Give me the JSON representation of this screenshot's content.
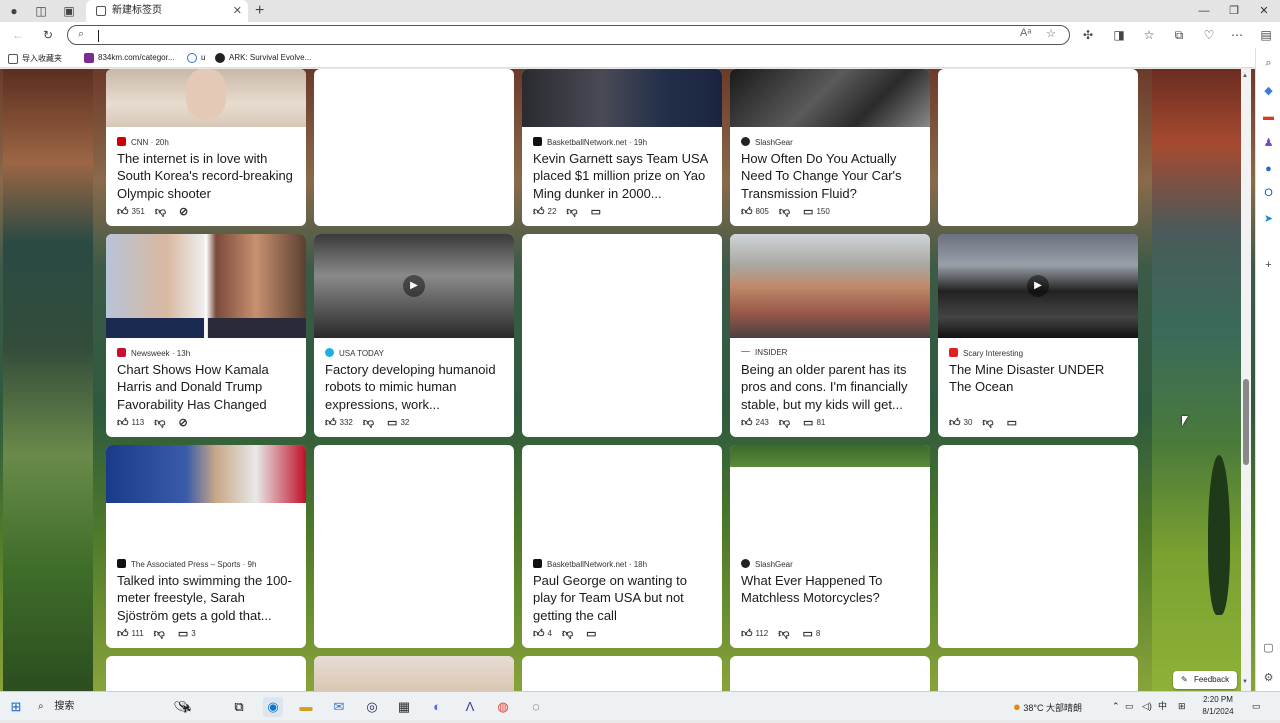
{
  "browser": {
    "tab_title": "新建标签页",
    "tab_close": "✕",
    "new_tab": "+",
    "address_value": "",
    "window_minimize": "—",
    "window_restore": "❐",
    "window_close": "✕"
  },
  "favorites": [
    {
      "label": "导入收藏夹",
      "color": "#555555"
    },
    {
      "label": "834km.com/categor...",
      "color": "#7b2d8e"
    },
    {
      "label": "u",
      "color": "#3a6fd8"
    },
    {
      "label": "ARK: Survival Evolve...",
      "color": "#222222"
    }
  ],
  "cards": {
    "c1": {
      "source": "CNN",
      "time": "20h",
      "title": "The internet is in love with South Korea's record-breaking Olympic shooter",
      "likes": "351",
      "comments": "",
      "logo_color": "#cc0000"
    },
    "c2": {
      "source": "BasketballNetwork.net",
      "time": "19h",
      "title": "Kevin Garnett says Team USA placed $1 million prize on Yao Ming dunker in 2000...",
      "likes": "22",
      "comments": "",
      "logo_color": "#111111"
    },
    "c3": {
      "source": "SlashGear",
      "time": "",
      "title": "How Often Do You Actually Need To Change Your Car's Transmission Fluid?",
      "likes": "805",
      "comments": "150",
      "logo_color": "#222222"
    },
    "c4": {
      "source": "Newsweek",
      "time": "13h",
      "title": "Chart Shows How Kamala Harris and Donald Trump Favorability Has Changed",
      "likes": "113",
      "comments": "",
      "logo_color": "#c8102e"
    },
    "c5": {
      "source": "USA TODAY",
      "time": "",
      "title": "Factory developing humanoid robots to mimic human expressions, work...",
      "likes": "332",
      "comments": "32",
      "logo_color": "#1ab0e0"
    },
    "c6": {
      "source": "INSIDER",
      "time": "",
      "title": "Being an older parent has its pros and cons. I'm financially stable, but my kids will get...",
      "likes": "243",
      "comments": "81",
      "logo_color": "#888888"
    },
    "c7": {
      "source": "Scary Interesting",
      "time": "",
      "title": "The Mine Disaster UNDER The Ocean",
      "likes": "30",
      "comments": "",
      "logo_color": "#e02020"
    },
    "c8": {
      "source": "The Associated Press – Sports",
      "time": "9h",
      "title": "Talked into swimming the 100-meter freestyle, Sarah Sjöström gets a gold that...",
      "likes": "111",
      "comments": "3",
      "logo_color": "#111111"
    },
    "c9": {
      "source": "BasketballNetwork.net",
      "time": "18h",
      "title": "Paul George on wanting to play for Team USA but not getting the call",
      "likes": "4",
      "comments": "",
      "logo_color": "#111111"
    },
    "c10": {
      "source": "SlashGear",
      "time": "",
      "title": "What Ever Happened To Matchless Motorcycles?",
      "likes": "112",
      "comments": "8",
      "logo_color": "#222222"
    }
  },
  "feedback_label": "Feedback",
  "taskbar": {
    "search_label": "搜索",
    "weather": "38°C 大部晴朗",
    "ime": "中",
    "time": "2:20 PM",
    "date": "8/1/2024"
  }
}
